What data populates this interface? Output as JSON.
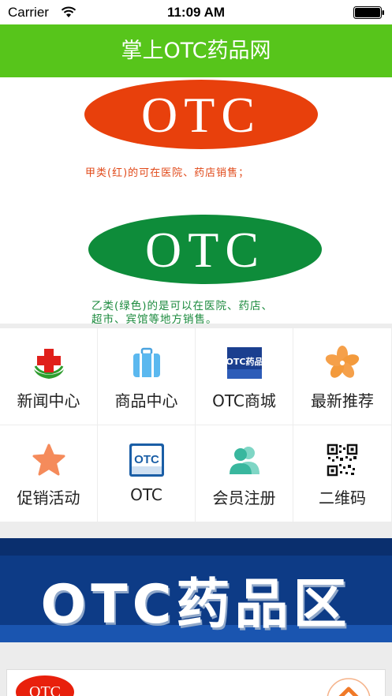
{
  "status_bar": {
    "carrier": "Carrier",
    "time": "11:09 AM"
  },
  "nav": {
    "title": "掌上OTC药品网"
  },
  "banner": {
    "red_logo_text": "OTC",
    "red_caption": "甲类(红)的可在医院、药店销售；",
    "green_logo_text": "OTC",
    "green_caption_line1": "乙类(绿色)的是可以在医院、药店、",
    "green_caption_line2": "超市、宾馆等地方销售。",
    "colors": {
      "red": "#e8400c",
      "green": "#0e8c3a"
    }
  },
  "grid": {
    "items": [
      {
        "label": "新闻中心",
        "icon": "red-cross-icon"
      },
      {
        "label": "商品中心",
        "icon": "luggage-icon"
      },
      {
        "label": "OTC商城",
        "icon": "otc-pharmacy-icon",
        "icon_text": "OTC药品"
      },
      {
        "label": "最新推荐",
        "icon": "flower-icon"
      },
      {
        "label": "促销活动",
        "icon": "star-icon"
      },
      {
        "label": "OTC",
        "icon": "otc-badge-icon",
        "icon_text": "OTC"
      },
      {
        "label": "会员注册",
        "icon": "users-icon"
      },
      {
        "label": "二维码",
        "icon": "qr-code-icon"
      }
    ]
  },
  "zone_banner": {
    "text": "OTC药品区",
    "colors": {
      "background": "#0d3b86"
    }
  },
  "bottom": {
    "logo_text": "OTC"
  },
  "colors": {
    "accent": "#57c51b"
  }
}
